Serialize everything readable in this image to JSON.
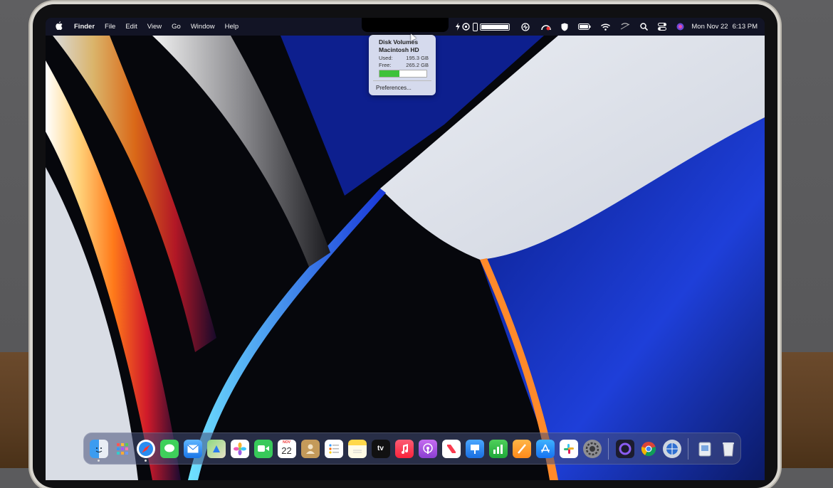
{
  "menubar": {
    "apple": "",
    "items": [
      "Finder",
      "File",
      "Edit",
      "View",
      "Go",
      "Window",
      "Help"
    ],
    "date": "Mon Nov 22",
    "time": "6:13 PM"
  },
  "disk_menu": {
    "title": "Disk Volumes",
    "volume": "Macintosh HD",
    "used_label": "Used:",
    "used_value": "195.3 GB",
    "free_label": "Free:",
    "free_value": "265.2 GB",
    "used_fraction": 0.42,
    "preferences": "Preferences..."
  },
  "calendar": {
    "month": "NOV",
    "day": "22"
  },
  "tv_label": "tv",
  "colors": {
    "accent_green": "#3ec23a",
    "menubar": "#141628",
    "dock_tint": "#464e78"
  },
  "dock_apps": [
    "finder",
    "launchpad",
    "safari",
    "messages",
    "mail",
    "maps",
    "photos",
    "facetime",
    "calendar",
    "contacts",
    "reminders",
    "notes",
    "apple-tv",
    "music",
    "podcasts",
    "news",
    "keynote",
    "numbers",
    "pages",
    "app-store",
    "slack",
    "system-preferences",
    "unknown-app",
    "chrome",
    "network-utility",
    "downloads",
    "trash"
  ]
}
